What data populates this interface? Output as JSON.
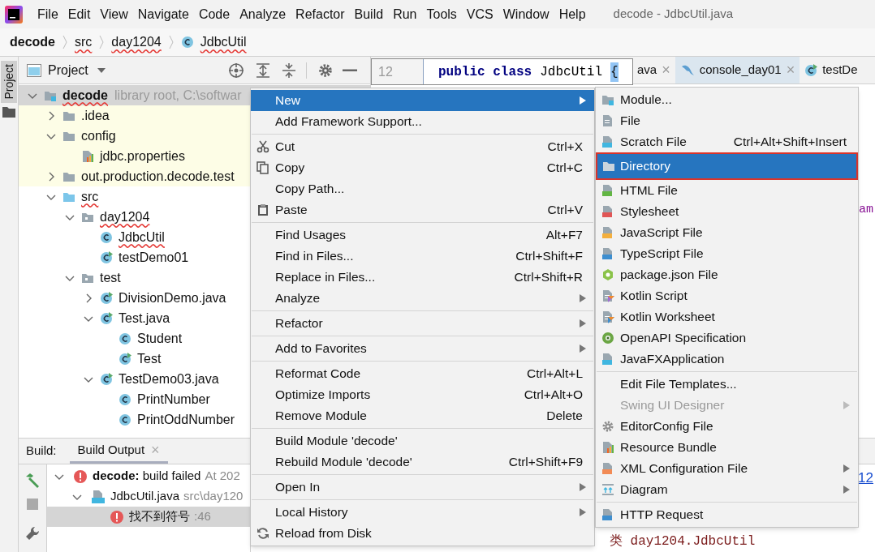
{
  "menu_bar": {
    "items": [
      "File",
      "Edit",
      "View",
      "Navigate",
      "Code",
      "Analyze",
      "Refactor",
      "Build",
      "Run",
      "Tools",
      "VCS",
      "Window",
      "Help"
    ],
    "title": "decode - JdbcUtil.java"
  },
  "breadcrumb": [
    {
      "label": "decode",
      "error": false
    },
    {
      "label": "src",
      "error": true
    },
    {
      "label": "day1204",
      "error": true
    },
    {
      "label": "JdbcUtil",
      "error": true,
      "kind": "class"
    }
  ],
  "side_strip": {
    "tab": "Project",
    "selected": true
  },
  "project_panel": {
    "title": "Project",
    "tree": [
      {
        "label": "decode",
        "note": "library root,  C:\\softwar",
        "kind": "module",
        "expanded": true,
        "selected": true,
        "error": true,
        "children": [
          {
            "label": ".idea",
            "kind": "folder",
            "expanded": false,
            "selected": false,
            "highlighted": true,
            "error": false
          },
          {
            "label": "config",
            "kind": "folder",
            "expanded": true,
            "selected": false,
            "highlighted": true,
            "error": false,
            "children": [
              {
                "label": "jdbc.properties",
                "kind": "properties",
                "selected": false,
                "highlighted": true,
                "error": false
              }
            ]
          },
          {
            "label": "out.production.decode.test",
            "kind": "folder",
            "expanded": false,
            "selected": false,
            "highlighted": true,
            "error": false
          },
          {
            "label": "src",
            "kind": "source",
            "expanded": true,
            "selected": false,
            "highlighted": false,
            "error": true,
            "children": [
              {
                "label": "day1204",
                "kind": "package",
                "expanded": true,
                "selected": false,
                "highlighted": false,
                "error": true,
                "children": [
                  {
                    "label": "JdbcUtil",
                    "kind": "class",
                    "selected": false,
                    "highlighted": false,
                    "error": true
                  },
                  {
                    "label": "testDemo01",
                    "kind": "runnable",
                    "selected": false,
                    "highlighted": false,
                    "error": false
                  }
                ]
              },
              {
                "label": "test",
                "kind": "package",
                "expanded": true,
                "selected": false,
                "highlighted": false,
                "error": false,
                "children": [
                  {
                    "label": "DivisionDemo.java",
                    "kind": "runnable",
                    "expanded": false,
                    "selected": false,
                    "highlighted": false,
                    "error": false
                  },
                  {
                    "label": "Test.java",
                    "kind": "runnable",
                    "expanded": true,
                    "selected": false,
                    "highlighted": false,
                    "error": false,
                    "children": [
                      {
                        "label": "Student",
                        "kind": "class",
                        "selected": false,
                        "highlighted": false,
                        "error": false
                      },
                      {
                        "label": "Test",
                        "kind": "runnable",
                        "selected": false,
                        "highlighted": false,
                        "error": false
                      }
                    ]
                  },
                  {
                    "label": "TestDemo03.java",
                    "kind": "runnable",
                    "expanded": true,
                    "selected": false,
                    "highlighted": false,
                    "error": false,
                    "children": [
                      {
                        "label": "PrintNumber",
                        "kind": "class",
                        "selected": false,
                        "highlighted": false,
                        "error": false
                      },
                      {
                        "label": "PrintOddNumber",
                        "kind": "class",
                        "selected": false,
                        "highlighted": false,
                        "error": false
                      }
                    ]
                  }
                ]
              }
            ]
          }
        ]
      }
    ]
  },
  "editor": {
    "tabs": [
      {
        "label": "ava",
        "close": "×",
        "color": "#f2f2f2"
      },
      {
        "label": "console_day01",
        "close": "×",
        "color": "#dbe6ef"
      },
      {
        "label": "testDe",
        "color": "#f2f2f2"
      }
    ],
    "fragment": "am"
  },
  "code_preview": {
    "line_number": "12",
    "tokens": [
      {
        "text": "public class",
        "kind": "keyword"
      },
      {
        "text": "JdbcUtil",
        "kind": "plain"
      },
      {
        "text": "{",
        "kind": "match"
      }
    ]
  },
  "build_panel": {
    "label": "Build:",
    "tabs": [
      {
        "label": "Build Output",
        "close": "×",
        "selected": true
      }
    ],
    "tree": [
      {
        "text": "**decode:** build failed",
        "note": "At 202",
        "kind": "error",
        "selected": false
      },
      {
        "text": "JdbcUtil.java",
        "note": "src\\day120",
        "kind": "file",
        "selected": false
      },
      {
        "text": "找不到符号",
        "note": ":46",
        "kind": "error",
        "selected": true
      }
    ],
    "link": "12",
    "output": "类 day1204.JdbcUtil"
  },
  "context_menu": {
    "groups": [
      [
        {
          "label": "New",
          "selected": true,
          "submenu": true
        },
        {
          "label": "Add Framework Support...",
          "selected": false,
          "submenu": false
        }
      ],
      [
        {
          "label": "Cut",
          "shortcut": "Ctrl+X",
          "selected": false,
          "submenu": false
        },
        {
          "label": "Copy",
          "shortcut": "Ctrl+C",
          "selected": false,
          "submenu": false
        },
        {
          "label": "Copy Path...",
          "selected": false,
          "submenu": false
        },
        {
          "label": "Paste",
          "shortcut": "Ctrl+V",
          "selected": false,
          "submenu": false
        }
      ],
      [
        {
          "label": "Find Usages",
          "shortcut": "Alt+F7",
          "selected": false,
          "submenu": false
        },
        {
          "label": "Find in Files...",
          "shortcut": "Ctrl+Shift+F",
          "selected": false,
          "submenu": false
        },
        {
          "label": "Replace in Files...",
          "shortcut": "Ctrl+Shift+R",
          "selected": false,
          "submenu": false
        },
        {
          "label": "Analyze",
          "selected": false,
          "submenu": true
        }
      ],
      [
        {
          "label": "Refactor",
          "selected": false,
          "submenu": true
        }
      ],
      [
        {
          "label": "Add to Favorites",
          "selected": false,
          "submenu": true
        }
      ],
      [
        {
          "label": "Reformat Code",
          "shortcut": "Ctrl+Alt+L",
          "selected": false,
          "submenu": false
        },
        {
          "label": "Optimize Imports",
          "shortcut": "Ctrl+Alt+O",
          "selected": false,
          "submenu": false
        },
        {
          "label": "Remove Module",
          "shortcut": "Delete",
          "selected": false,
          "submenu": false
        }
      ],
      [
        {
          "label": "Build Module 'decode'",
          "selected": false,
          "submenu": false
        },
        {
          "label": "Rebuild Module 'decode'",
          "shortcut": "Ctrl+Shift+F9",
          "selected": false,
          "submenu": false
        }
      ],
      [
        {
          "label": "Open In",
          "selected": false,
          "submenu": true
        }
      ],
      [
        {
          "label": "Local History",
          "selected": false,
          "submenu": true
        },
        {
          "label": "Reload from Disk",
          "selected": false,
          "submenu": false
        }
      ]
    ]
  },
  "new_submenu": {
    "groups": [
      [
        {
          "label": "Module...",
          "selected": false,
          "disabled": false,
          "submenu": false,
          "outlined": false
        },
        {
          "label": "File",
          "selected": false,
          "disabled": false,
          "submenu": false,
          "outlined": false
        },
        {
          "label": "Scratch File",
          "shortcut": "Ctrl+Alt+Shift+Insert",
          "selected": false,
          "disabled": false,
          "submenu": false,
          "outlined": false
        },
        {
          "label": "Directory",
          "selected": true,
          "disabled": false,
          "submenu": false,
          "outlined": true
        },
        {
          "label": "HTML File",
          "selected": false,
          "disabled": false,
          "submenu": false,
          "outlined": false
        },
        {
          "label": "Stylesheet",
          "selected": false,
          "disabled": false,
          "submenu": false,
          "outlined": false
        },
        {
          "label": "JavaScript File",
          "selected": false,
          "disabled": false,
          "submenu": false,
          "outlined": false
        },
        {
          "label": "TypeScript File",
          "selected": false,
          "disabled": false,
          "submenu": false,
          "outlined": false
        },
        {
          "label": "package.json File",
          "selected": false,
          "disabled": false,
          "submenu": false,
          "outlined": false
        },
        {
          "label": "Kotlin Script",
          "selected": false,
          "disabled": false,
          "submenu": false,
          "outlined": false
        },
        {
          "label": "Kotlin Worksheet",
          "selected": false,
          "disabled": false,
          "submenu": false,
          "outlined": false
        },
        {
          "label": "OpenAPI Specification",
          "selected": false,
          "disabled": false,
          "submenu": false,
          "outlined": false
        },
        {
          "label": "JavaFXApplication",
          "selected": false,
          "disabled": false,
          "submenu": false,
          "outlined": false
        }
      ],
      [
        {
          "label": "Edit File Templates...",
          "selected": false,
          "disabled": false,
          "submenu": false,
          "outlined": false
        },
        {
          "label": "Swing UI Designer",
          "selected": false,
          "disabled": true,
          "submenu": true,
          "outlined": false
        },
        {
          "label": "EditorConfig File",
          "selected": false,
          "disabled": false,
          "submenu": false,
          "outlined": false
        },
        {
          "label": "Resource Bundle",
          "selected": false,
          "disabled": false,
          "submenu": false,
          "outlined": false
        },
        {
          "label": "XML Configuration File",
          "selected": false,
          "disabled": false,
          "submenu": true,
          "outlined": false
        },
        {
          "label": "Diagram",
          "selected": false,
          "disabled": false,
          "submenu": true,
          "outlined": false
        }
      ],
      [
        {
          "label": "HTTP Request",
          "selected": false,
          "disabled": false,
          "submenu": false,
          "outlined": false
        }
      ]
    ]
  }
}
